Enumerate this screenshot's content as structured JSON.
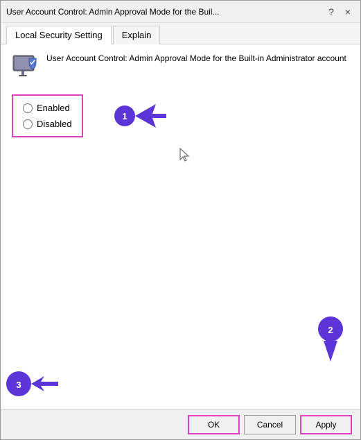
{
  "window": {
    "title": "User Account Control: Admin Approval Mode for the Buil...",
    "help_button": "?",
    "close_button": "×"
  },
  "tabs": [
    {
      "label": "Local Security Setting",
      "active": true
    },
    {
      "label": "Explain",
      "active": false
    }
  ],
  "setting": {
    "title": "User Account Control: Admin Approval Mode for the Built-in Administrator account",
    "options": [
      {
        "label": "Enabled",
        "value": "enabled",
        "checked": false
      },
      {
        "label": "Disabled",
        "value": "disabled",
        "checked": false
      }
    ]
  },
  "annotations": [
    {
      "number": "1"
    },
    {
      "number": "2"
    },
    {
      "number": "3"
    }
  ],
  "footer": {
    "ok_label": "OK",
    "cancel_label": "Cancel",
    "apply_label": "Apply"
  }
}
